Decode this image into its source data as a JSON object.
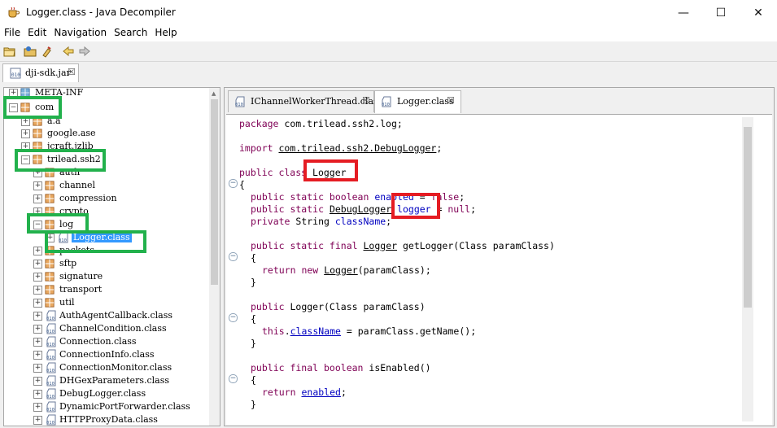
{
  "window": {
    "title": "Logger.class - Java Decompiler",
    "minimize": "—",
    "maximize": "☐",
    "close": "✕"
  },
  "menu": [
    "File",
    "Edit",
    "Navigation",
    "Search",
    "Help"
  ],
  "file_tab": {
    "label": "dji-sdk.jar",
    "close": "☒"
  },
  "tree": [
    {
      "label": "META-INF",
      "icon": "package",
      "selected": false
    },
    {
      "label": "com",
      "icon": "package",
      "selected": false
    },
    {
      "label": "a.a",
      "icon": "package",
      "selected": false
    },
    {
      "label": "google.ase",
      "icon": "package",
      "selected": false
    },
    {
      "label": "jcraft.jzlib",
      "icon": "package",
      "selected": false
    },
    {
      "label": "trilead.ssh2",
      "icon": "package",
      "selected": false
    },
    {
      "label": "auth",
      "icon": "package",
      "selected": false
    },
    {
      "label": "channel",
      "icon": "package",
      "selected": false
    },
    {
      "label": "compression",
      "icon": "package",
      "selected": false
    },
    {
      "label": "crypto",
      "icon": "package",
      "selected": false
    },
    {
      "label": "log",
      "icon": "package",
      "selected": false
    },
    {
      "label": "Logger.class",
      "icon": "class",
      "selected": true
    },
    {
      "label": "packets",
      "icon": "package",
      "selected": false
    },
    {
      "label": "sftp",
      "icon": "package",
      "selected": false
    },
    {
      "label": "signature",
      "icon": "package",
      "selected": false
    },
    {
      "label": "transport",
      "icon": "package",
      "selected": false
    },
    {
      "label": "util",
      "icon": "package",
      "selected": false
    },
    {
      "label": "AuthAgentCallback.class",
      "icon": "class",
      "selected": false
    },
    {
      "label": "ChannelCondition.class",
      "icon": "class",
      "selected": false
    },
    {
      "label": "Connection.class",
      "icon": "class",
      "selected": false
    },
    {
      "label": "ConnectionInfo.class",
      "icon": "class",
      "selected": false
    },
    {
      "label": "ConnectionMonitor.class",
      "icon": "class",
      "selected": false
    },
    {
      "label": "DHGexParameters.class",
      "icon": "class",
      "selected": false
    },
    {
      "label": "DebugLogger.class",
      "icon": "class",
      "selected": false
    },
    {
      "label": "DynamicPortForwarder.class",
      "icon": "class",
      "selected": false
    },
    {
      "label": "HTTPProxyData.class",
      "icon": "class",
      "selected": false
    }
  ],
  "editor_tabs": [
    {
      "label": "IChannelWorkerThread.class",
      "close": "☒",
      "active": false
    },
    {
      "label": "Logger.class",
      "close": "☒",
      "active": true
    }
  ],
  "code": {
    "l1_kw": "package",
    "l1_rest": " com.trilead.ssh2.log;",
    "l2_kw": "import",
    "l2_sp": " ",
    "l2_ref": "com.trilead.ssh2.DebugLogger",
    "l2_end": ";",
    "l3_kw": "public class",
    "l3_name": " Logger",
    "l4": "{",
    "l5_kw": "public static boolean",
    "l5_f": " enabled",
    "l5_mid": " = ",
    "l5_kw2": "false",
    "l5_end": ";",
    "l6_kw": "public static",
    "l6_sp": " ",
    "l6_ref": "DebugLogger",
    "l6_f": " logger",
    "l6_mid": " = ",
    "l6_kw2": "null",
    "l6_end": ";",
    "l7_kw": "private",
    "l7_rest": " String ",
    "l7_f": "className",
    "l7_end": ";",
    "l8_kw": "public static final",
    "l8_sp": " ",
    "l8_ref": "Logger",
    "l8_rest": " getLogger(Class paramClass)",
    "l9": "{",
    "l10_kw": "return new",
    "l10_sp": " ",
    "l10_ref": "Logger",
    "l10_rest": "(paramClass);",
    "l11": "}",
    "l12_kw": "public",
    "l12_rest": " Logger(Class paramClass)",
    "l13": "{",
    "l14_kw": "this",
    "l14_dot": ".",
    "l14_f": "className",
    "l14_rest": " = paramClass.getName();",
    "l15": "}",
    "l16_kw": "public final boolean",
    "l16_rest": " isEnabled()",
    "l17": "{",
    "l18_kw": "return",
    "l18_sp": " ",
    "l18_f": "enabled",
    "l18_end": ";",
    "l19": "}"
  },
  "colors": {
    "annotation_green": "#22b14c",
    "annotation_red": "#e51c23",
    "keyword": "#7f0055",
    "field": "#0000c0",
    "selection": "#3399ff"
  },
  "icons": {
    "app": "coffee-cup-icon",
    "package": "package-icon",
    "class": "class-file-icon",
    "fold": "fold-minus-icon"
  }
}
